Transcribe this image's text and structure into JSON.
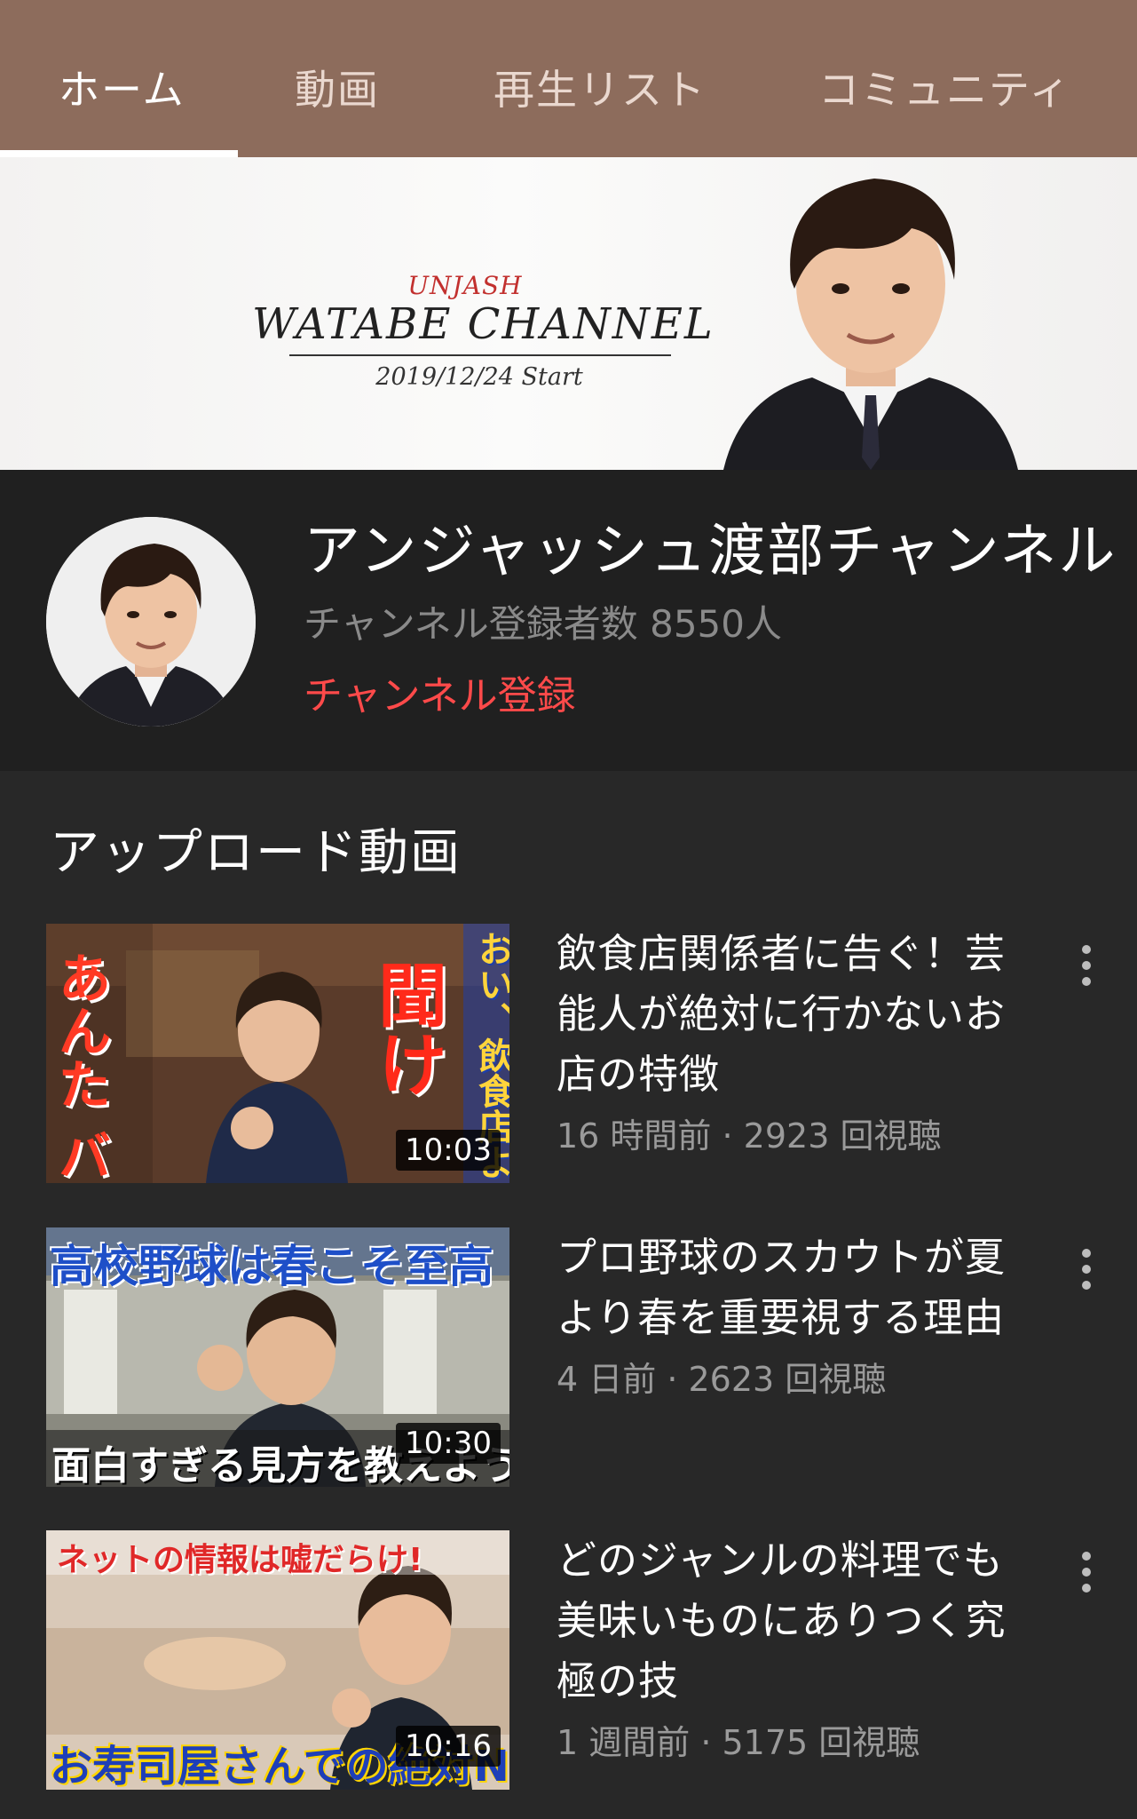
{
  "tabs": [
    {
      "label": "ホーム",
      "active": true
    },
    {
      "label": "動画"
    },
    {
      "label": "再生リスト"
    },
    {
      "label": "コミュニティ"
    }
  ],
  "banner": {
    "logo_small": "UNJASH",
    "logo_main": "WATABE CHANNEL",
    "start": "2019/12/24 Start"
  },
  "channel": {
    "name": "アンジャッシュ渡部チャンネル",
    "subscribers": "チャンネル登録者数 8550人",
    "subscribe_label": "チャンネル登録"
  },
  "section_title": "アップロード動画",
  "videos": [
    {
      "title": "飲食店関係者に告ぐ！芸能人が絶対に行かないお店の特徴",
      "meta": "16 時間前 · 2923 回視聴",
      "duration": "10:03",
      "thumb_texts": {
        "left": "あんた バカだろ",
        "mid": "聞け",
        "right": "おい、飲食店よ"
      }
    },
    {
      "title": "プロ野球のスカウトが夏より春を重要視する理由",
      "meta": "4 日前 · 2623 回視聴",
      "duration": "10:30",
      "thumb_texts": {
        "top": "高校野球は春こそ至高",
        "bottom": "面白すぎる見方を教えよう"
      }
    },
    {
      "title": "どのジャンルの料理でも美味いものにありつく究極の技",
      "meta": "1 週間前 · 5175 回視聴",
      "duration": "10:16",
      "thumb_texts": {
        "top": "ネットの情報は嘘だらけ!",
        "bottom": "お寿司屋さんでの絶対NGワード"
      }
    }
  ],
  "colors": {
    "tabbar": "#8d6c5c",
    "subscribe": "#ff4a4a",
    "background": "#212121"
  },
  "icons": {
    "more": "more-vert-icon"
  }
}
